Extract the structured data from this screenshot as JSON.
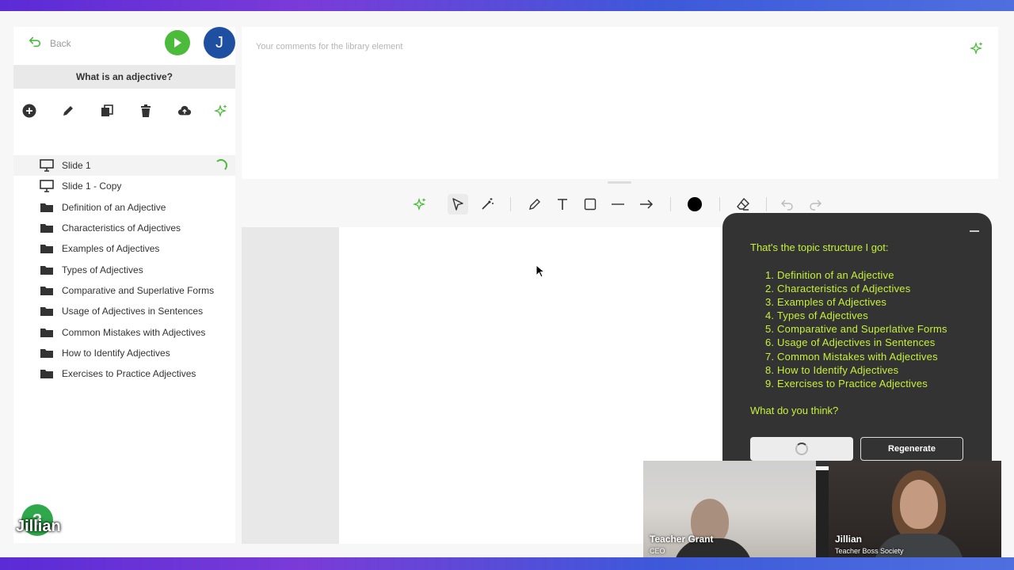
{
  "sidebar": {
    "back_label": "Back",
    "avatar_initial": "J",
    "lesson_title": "What is an adjective?",
    "items": [
      {
        "label": "Slide 1",
        "type": "slide"
      },
      {
        "label": "Slide 1 - Copy",
        "type": "slide"
      },
      {
        "label": "Definition of an Adjective",
        "type": "folder"
      },
      {
        "label": "Characteristics of Adjectives",
        "type": "folder"
      },
      {
        "label": "Examples of Adjectives",
        "type": "folder"
      },
      {
        "label": "Types of Adjectives",
        "type": "folder"
      },
      {
        "label": "Comparative and Superlative Forms",
        "type": "folder"
      },
      {
        "label": "Usage of Adjectives in Sentences",
        "type": "folder"
      },
      {
        "label": "Common Mistakes with Adjectives",
        "type": "folder"
      },
      {
        "label": "How to Identify Adjectives",
        "type": "folder"
      },
      {
        "label": "Exercises to Practice Adjectives",
        "type": "folder"
      }
    ]
  },
  "comments": {
    "placeholder": "Your comments for the library element"
  },
  "ai_panel": {
    "intro": "That's the topic structure I got:",
    "topics": [
      "1. Definition of an Adjective",
      "2. Characteristics of Adjectives",
      "3. Examples of Adjectives",
      "4. Types of Adjectives",
      "5. Comparative and Superlative Forms",
      "6. Usage of Adjectives in Sentences",
      "7. Common Mistakes with Adjectives",
      "8. How to Identify Adjectives",
      "9. Exercises to Practice Adjectives"
    ],
    "question": "What do you think?",
    "regenerate_label": "Regenerate"
  },
  "videos": {
    "grant_name": "Teacher Grant",
    "grant_role": "CEO",
    "jillian_name": "Jillian",
    "jillian_role": "Teacher Boss Society"
  },
  "overlay": {
    "help_label": "?",
    "speaker_label": "Jillian"
  },
  "colors": {
    "accent_green": "#4cbb3c",
    "ai_text": "#c6f03a",
    "avatar_blue": "#1e4fa0"
  }
}
